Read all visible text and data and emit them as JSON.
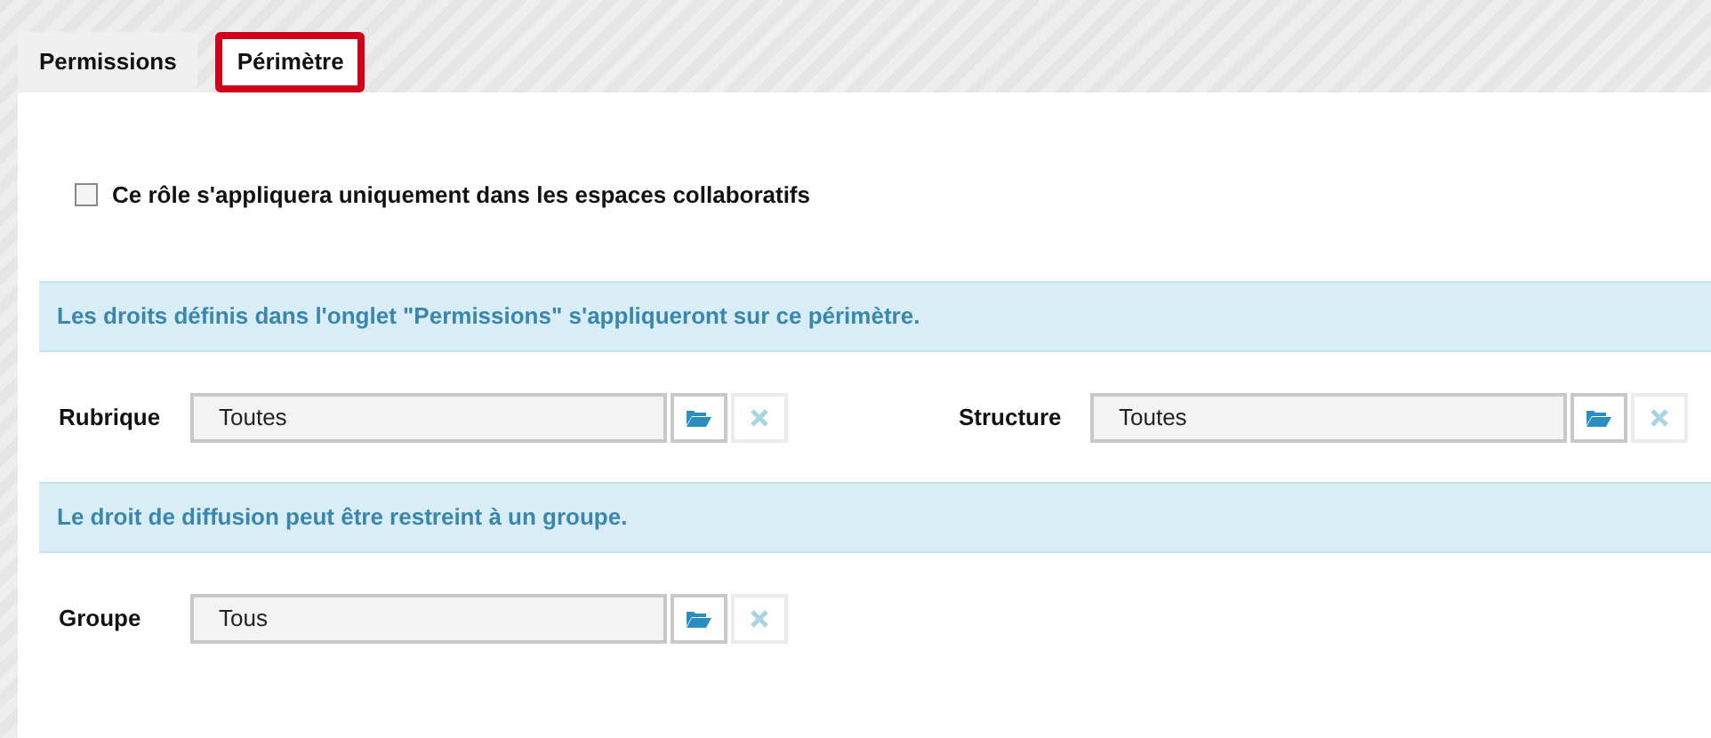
{
  "tabs": [
    {
      "label": "Permissions",
      "selected": false,
      "highlighted": false
    },
    {
      "label": "Périmètre",
      "selected": true,
      "highlighted": true
    }
  ],
  "scope_checkbox": {
    "label": "Ce rôle s'appliquera uniquement dans les espaces collaboratifs",
    "checked": false
  },
  "sections": [
    {
      "notice": "Les droits définis dans l'onglet \"Permissions\" s'appliqueront sur ce périmètre.",
      "fields": [
        {
          "label": "Rubrique",
          "value": "Toutes"
        },
        {
          "label": "Structure",
          "value": "Toutes"
        }
      ]
    },
    {
      "notice": "Le droit de diffusion peut être restreint à un groupe.",
      "fields": [
        {
          "label": "Groupe",
          "value": "Tous"
        }
      ]
    }
  ]
}
